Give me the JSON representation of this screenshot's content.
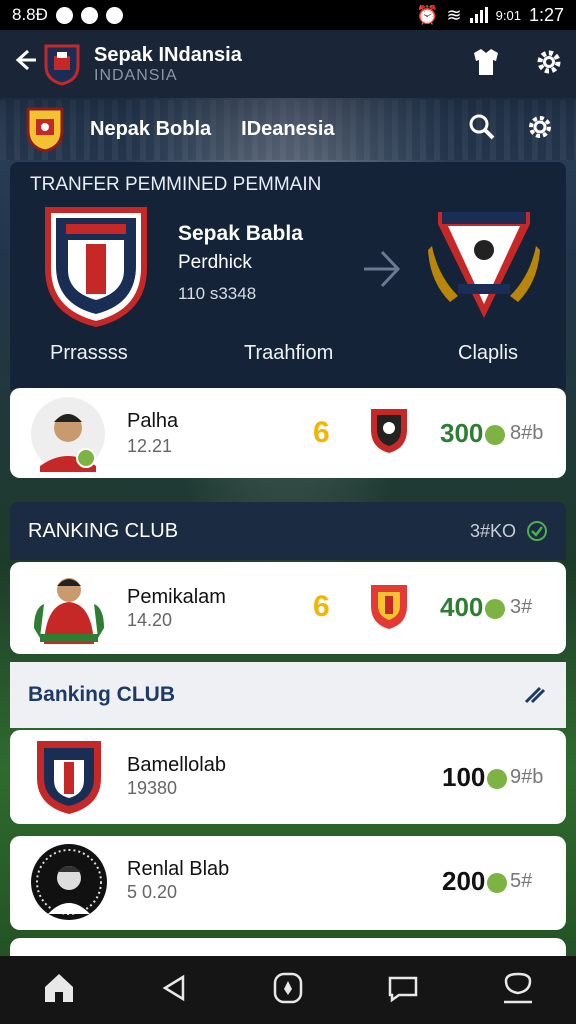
{
  "status_bar": {
    "left_text": "8.8Ð",
    "time": "1:27",
    "network": "9:01"
  },
  "app_bar": {
    "title": "Sepak INdansia",
    "subtitle": "INDANSIA"
  },
  "nav2": {
    "label1": "Nepak Bobla",
    "label2": "IDeanesia"
  },
  "transfer": {
    "header": "TRANFER PEMMINED PEMMAIN",
    "club_name": "Sepak Babla",
    "position": "Perdhick",
    "value": "110 s3348",
    "label_left": "Prrassss",
    "label_mid": "Traahfiom",
    "label_right": "Claplis"
  },
  "rows": [
    {
      "name": "Palha",
      "sub": "12.21",
      "number": "6",
      "points": "300",
      "extra": "8#b"
    },
    {
      "name": "Pemikalam",
      "sub": "14.20",
      "number": "6",
      "points": "400",
      "extra": "3#"
    },
    {
      "name": "Bamellolab",
      "sub": "19380",
      "points": "100",
      "extra": "9#b"
    },
    {
      "name": "Renlal Blab",
      "sub": "5 0.20",
      "points": "200",
      "extra": "5#"
    }
  ],
  "ranking_band": {
    "title": "RANKING CLUB",
    "right_text": "3#KO"
  },
  "banking_section": {
    "title": "Banking CLUB"
  },
  "colors": {
    "accent_yellow": "#f4b400",
    "points_green": "#2e7d32",
    "navy": "#142338"
  },
  "icons": [
    "back-arrow-icon",
    "jersey-icon",
    "gear-icon",
    "search-icon",
    "check-icon",
    "edit-icon",
    "home-icon",
    "back-nav-icon",
    "compass-icon",
    "chat-icon",
    "profile-icon"
  ]
}
